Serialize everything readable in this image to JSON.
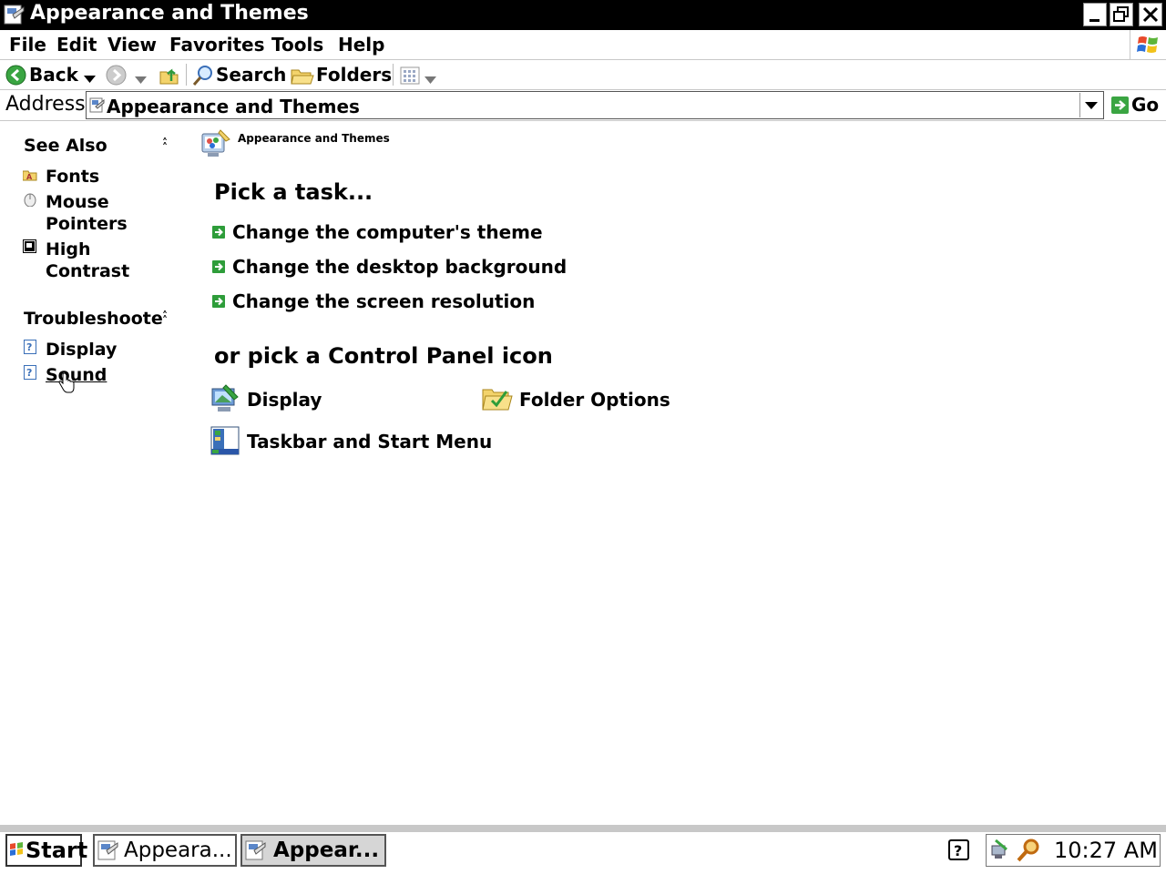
{
  "window": {
    "title": "Appearance and Themes"
  },
  "menu": [
    "File",
    "Edit",
    "View",
    "Favorites",
    "Tools",
    "Help"
  ],
  "toolbar": {
    "back": "Back",
    "search": "Search",
    "folders": "Folders"
  },
  "address": {
    "label": "Address",
    "value": "Appearance and Themes",
    "go": "Go"
  },
  "see_also": {
    "title": "See Also",
    "items": [
      {
        "line1": "Fonts",
        "line2": ""
      },
      {
        "line1": "Mouse",
        "line2": "Pointers"
      },
      {
        "line1": "High",
        "line2": "Contrast"
      }
    ]
  },
  "troubleshoot": {
    "title": "Troubleshoote",
    "items": [
      "Display",
      "Sound"
    ]
  },
  "main": {
    "breadcrumb": "Appearance and Themes",
    "pick_task": "Pick a task...",
    "tasks": [
      "Change the computer's theme",
      "Change the desktop background",
      "Change the screen resolution"
    ],
    "pick_icon": "or pick a Control Panel icon",
    "icons": [
      "Display",
      "Folder Options",
      "Taskbar and Start Menu"
    ]
  },
  "taskbar": {
    "start": "Start",
    "tasks": [
      "Appeara...",
      "Appear..."
    ],
    "clock": "10:27 AM"
  },
  "colors": {
    "titlebar": "#000000",
    "link_arrow": "#2e9d3a",
    "taskbar": "#c8c8c8"
  }
}
